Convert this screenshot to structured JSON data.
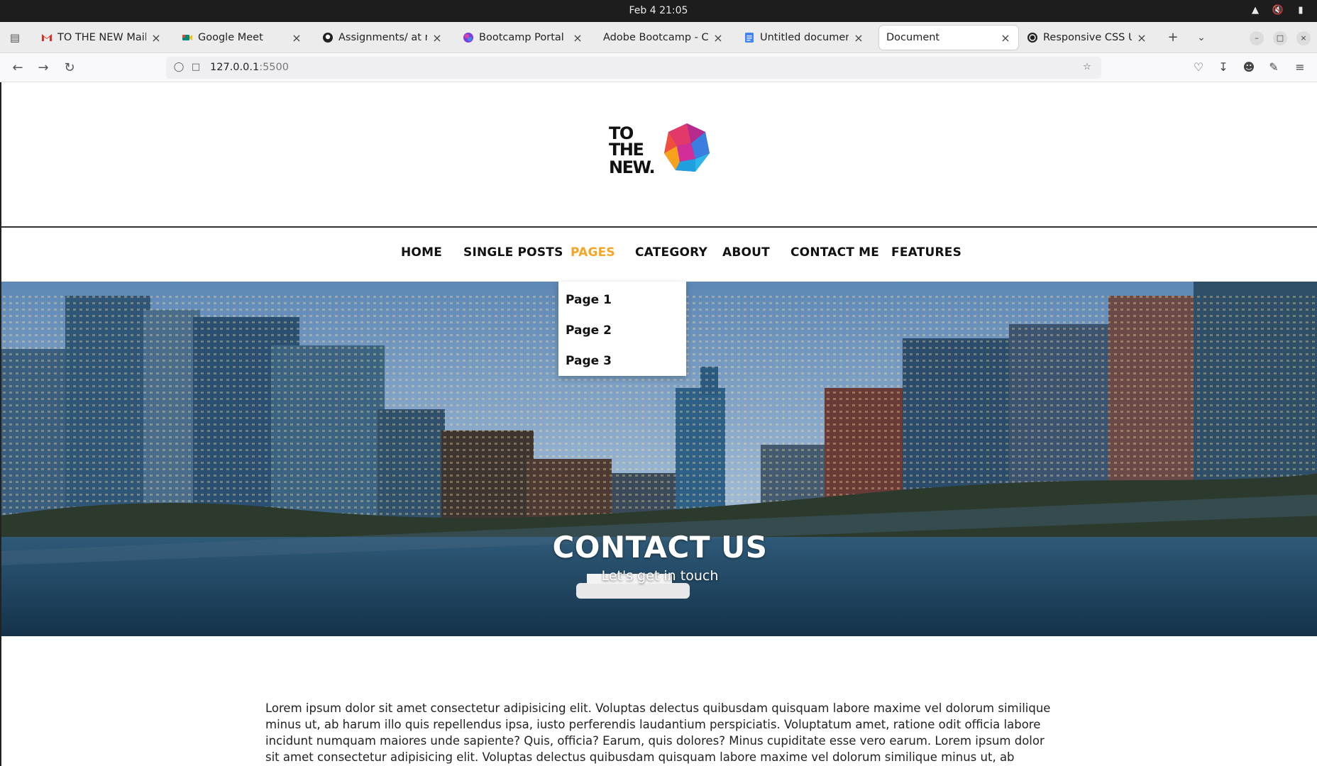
{
  "os": {
    "clock": "Feb 4  21:05",
    "tray_icons": [
      "wifi-icon",
      "volume-muted-icon",
      "battery-icon"
    ]
  },
  "browser": {
    "tabs": [
      {
        "label": "TO THE NEW Mail",
        "favicon": "gmail-icon",
        "color": "#d93025",
        "active": false
      },
      {
        "label": "Google Meet",
        "favicon": "google-meet-icon",
        "color": "#00897b",
        "active": false
      },
      {
        "label": "Assignments/ at main",
        "favicon": "github-icon",
        "color": "#222222",
        "active": false
      },
      {
        "label": "Bootcamp Portal",
        "favicon": "bootcamp-portal-icon",
        "color": "#7b3fe4",
        "active": false
      },
      {
        "label": "Adobe Bootcamp - CSS.p",
        "favicon": "adobe-icon",
        "color": "#ffffff",
        "active": false
      },
      {
        "label": "Untitled document - G",
        "favicon": "google-docs-icon",
        "color": "#4285f4",
        "active": false
      },
      {
        "label": "Document",
        "favicon": "",
        "color": "#ffffff",
        "active": true
      },
      {
        "label": "Responsive CSS Upda",
        "favicon": "openai-icon",
        "color": "#222222",
        "active": false
      }
    ],
    "url": {
      "host": "127.0.0.1",
      "port": ":5500"
    }
  },
  "site": {
    "logo_text": "TO THE NEW.",
    "nav": [
      {
        "label": "HOME",
        "active": false
      },
      {
        "label": "SINGLE POSTS",
        "active": false
      },
      {
        "label": "PAGES",
        "active": true
      },
      {
        "label": "CATEGORY",
        "active": false
      },
      {
        "label": "ABOUT",
        "active": false
      },
      {
        "label": "CONTACT ME",
        "active": false
      },
      {
        "label": "FEATURES",
        "active": false
      }
    ],
    "pages_dropdown": [
      "Page 1",
      "Page 2",
      "Page 3"
    ],
    "hero": {
      "title": "CONTACT US",
      "subtitle": "Let's get in touch"
    },
    "body_text": "Lorem ipsum dolor sit amet consectetur adipisicing elit. Voluptas delectus quibusdam quisquam labore maxime vel dolorum similique minus ut, ab harum illo quis repellendus ipsa, iusto perferendis laudantium perspiciatis. Voluptatum amet, ratione odit officia labore incidunt numquam maiores unde sapiente? Quis, officia? Earum, quis dolores? Minus cupiditate esse vero earum. Lorem ipsum dolor sit amet consectetur adipisicing elit. Voluptas delectus quibusdam quisquam labore maxime vel dolorum similique minus ut, ab harum illo quis repellendus ipsa, iusto perferendis",
    "colors": {
      "nav_active": "#f5a524",
      "text": "#111111"
    }
  }
}
